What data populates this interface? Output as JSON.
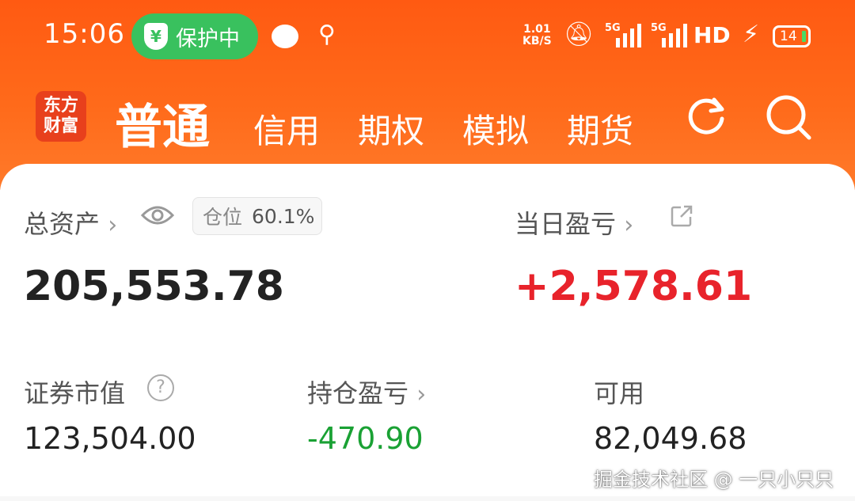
{
  "status_bar": {
    "time": "15:06",
    "protect_label": "保护中",
    "protect_shield_glyph": "¥",
    "net_speed_value": "1.01",
    "net_speed_unit": "KB/S",
    "signal1_label": "5G",
    "signal2_label": "5G",
    "hd_label": "HD",
    "battery_level": "14"
  },
  "app": {
    "logo_line1": "东方",
    "logo_line2": "财富",
    "tabs": [
      {
        "label": "普通",
        "active": true
      },
      {
        "label": "信用",
        "active": false
      },
      {
        "label": "期权",
        "active": false
      },
      {
        "label": "模拟",
        "active": false
      },
      {
        "label": "期货",
        "active": false
      }
    ]
  },
  "account": {
    "total_assets_label": "总资产",
    "total_assets_value": "205,553.78",
    "position_label": "仓位",
    "position_value": "60.1%",
    "daily_pnl_label": "当日盈亏",
    "daily_pnl_value": "+2,578.61",
    "market_value_label": "证券市值",
    "market_value": "123,504.00",
    "holding_pnl_label": "持仓盈亏",
    "holding_pnl_value": "-470.90",
    "available_label": "可用",
    "available_value": "82,049.68"
  },
  "watermark": "掘金技术社区 @ 一只小只只",
  "colors": {
    "header": "#ff6a1a",
    "profit": "#e8232b",
    "loss": "#1aa134",
    "protect_badge": "#39c15e"
  }
}
